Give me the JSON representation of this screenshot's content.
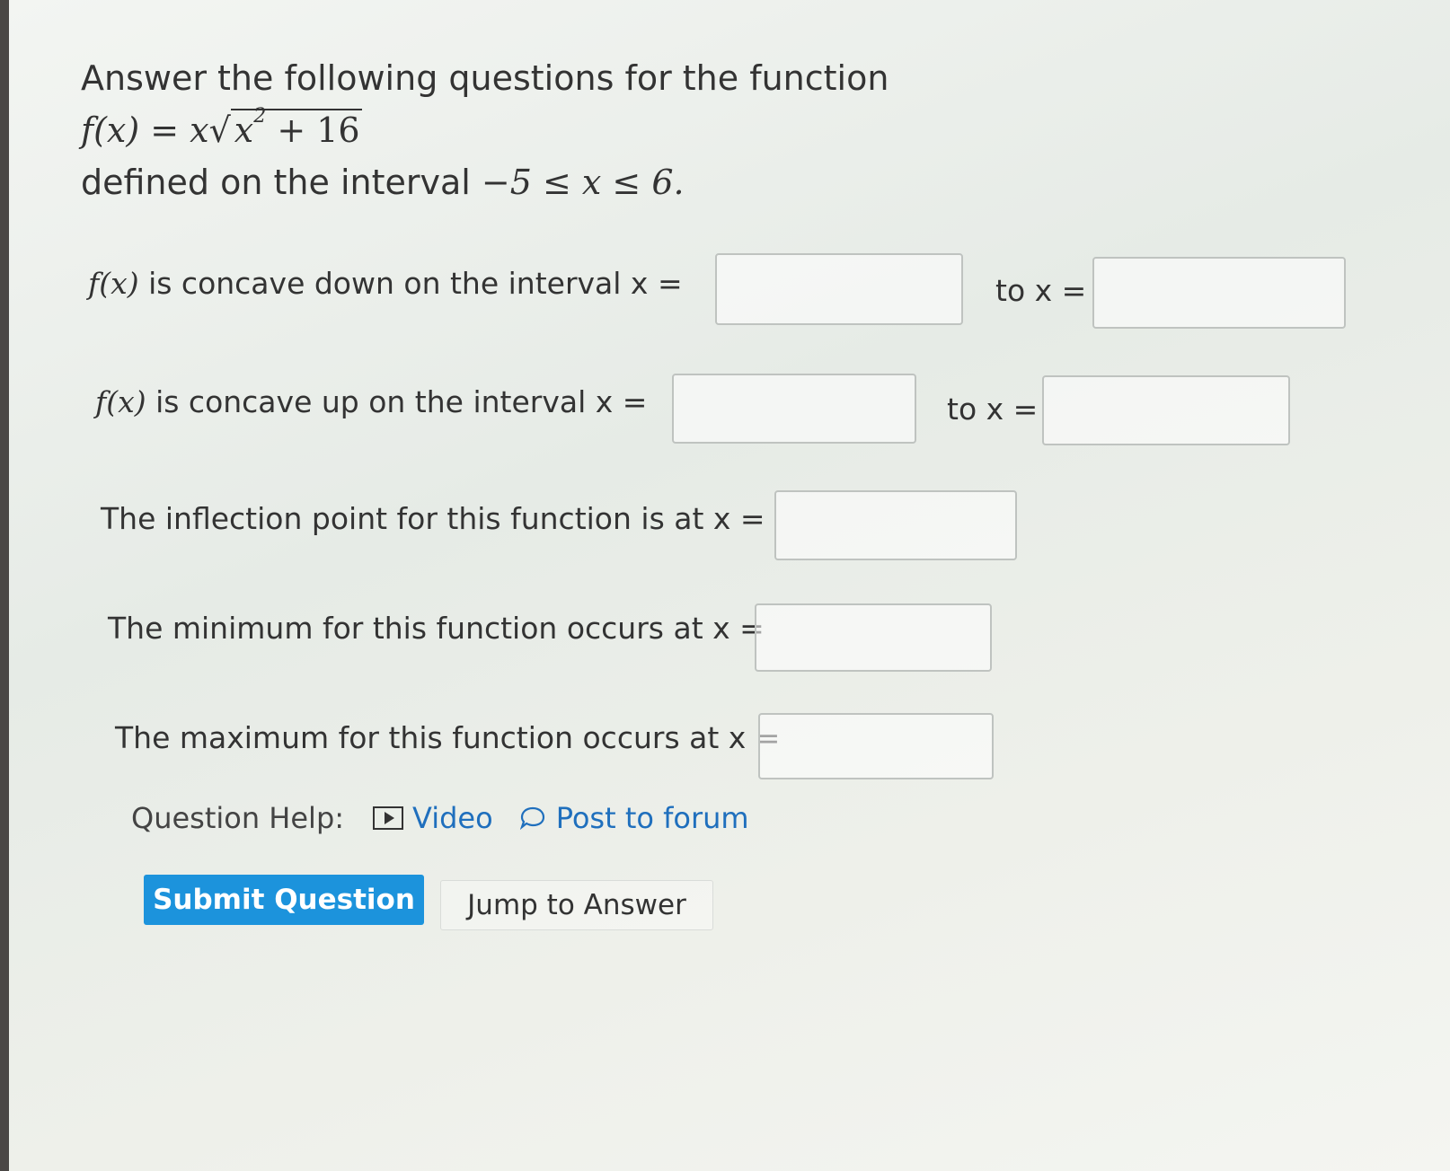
{
  "question": {
    "prompt": "Answer the following questions for the function",
    "function_lhs": "f(x) = x",
    "function_radicand_base": "x",
    "function_radicand_exp": "2",
    "function_radicand_rest": " + 16",
    "interval_prefix": "defined on the interval ",
    "interval_math": "−5 ≤ x ≤ 6."
  },
  "rows": {
    "concave_down": {
      "fx": "f(x)",
      "label": " is concave down on the interval x =",
      "to_label": "to x ="
    },
    "concave_up": {
      "fx": "f(x)",
      "label": " is concave up on the interval x =",
      "to_label": "to x ="
    },
    "inflection": {
      "label": "The inflection point for this function is at x ="
    },
    "minimum": {
      "label": "The minimum for this function occurs at x ="
    },
    "maximum": {
      "label": "The maximum for this function occurs at x ="
    }
  },
  "help": {
    "label": "Question Help:",
    "video": "Video",
    "forum": "Post to forum",
    "video_icon": "video-play-icon",
    "forum_icon": "speech-bubble-icon"
  },
  "buttons": {
    "submit": "Submit Question",
    "jump": "Jump to Answer"
  },
  "colors": {
    "submit_bg": "#1c93dc",
    "link": "#1f6fbd"
  }
}
